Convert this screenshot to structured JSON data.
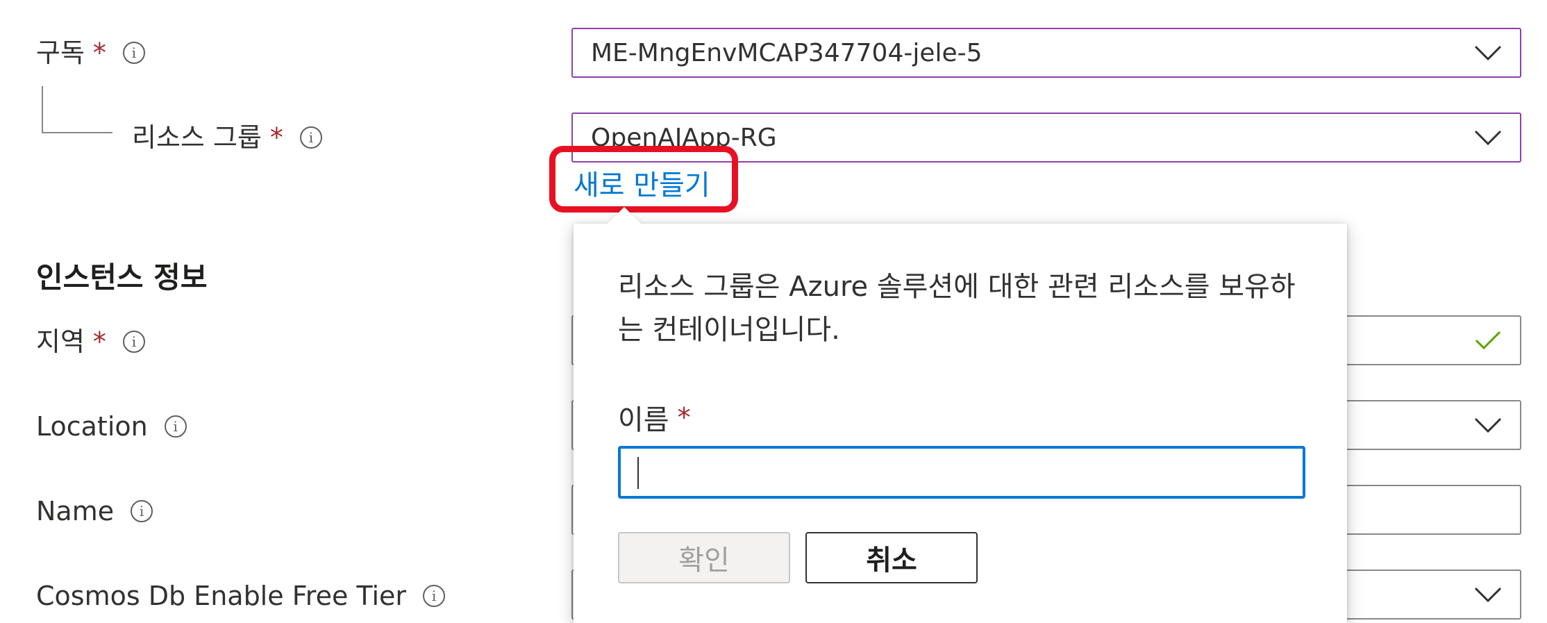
{
  "form": {
    "subscription": {
      "label": "구독",
      "required": "*",
      "value": "ME-MngEnvMCAP347704-jele-5"
    },
    "resource_group": {
      "label": "리소스 그룹",
      "required": "*",
      "value": "OpenAIApp-RG",
      "create_new_link": "새로 만들기"
    },
    "instance_section_title": "인스턴스 정보",
    "region": {
      "label": "지역",
      "required": "*"
    },
    "location": {
      "label": "Location"
    },
    "name": {
      "label": "Name"
    },
    "cosmos": {
      "label": "Cosmos Db Enable Free Tier"
    }
  },
  "popup": {
    "description": "리소스 그룹은 Azure 솔루션에 대한 관련 리소스를 보유하는 컨테이너입니다.",
    "name_label": "이름",
    "name_required": "*",
    "name_value": "",
    "ok_button": "확인",
    "cancel_button": "취소"
  },
  "icons": {
    "info": "info-icon",
    "chevron": "chevron-down-icon",
    "check": "checkmark-icon"
  },
  "colors": {
    "accent": "#0078d4",
    "required": "#a4262c",
    "highlight": "#e81123",
    "valid": "#57a300",
    "focus_border": "#8e3fa8"
  }
}
